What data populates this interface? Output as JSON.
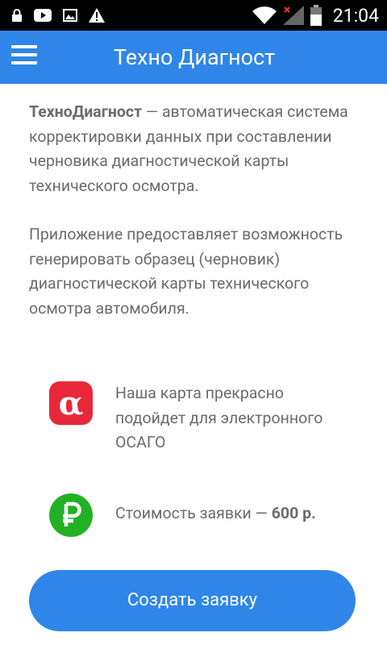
{
  "status_bar": {
    "time": "21:04",
    "icons": [
      "lock-icon",
      "youtube-icon",
      "image-icon",
      "warning-icon",
      "wifi-icon",
      "signal-icon",
      "battery-icon"
    ]
  },
  "app_bar": {
    "title": "Техно Диагност",
    "menu_icon": "hamburger-menu-icon"
  },
  "intro": {
    "brand": "ТехноДиагност",
    "text": " — автоматическая система корректировки данных при составлении черновика диагностической карты технического осмотра."
  },
  "description": "Приложение предоставляет возможность генерировать образец (черновик) диагностической карты технического осмотра автомобиля.",
  "features": [
    {
      "icon": "alfa-logo-icon",
      "text": "Наша карта прекрасно подойдет для электронного ОСАГО"
    },
    {
      "icon": "ruble-icon",
      "text_prefix": "Стоимость заявки — ",
      "text_price": "600 р."
    }
  ],
  "cta": {
    "label": "Создать заявку"
  },
  "colors": {
    "primary": "#2f86e8",
    "text": "#6b6b6b",
    "alfa_red": "#e8273a",
    "ruble_green": "#22b125"
  }
}
